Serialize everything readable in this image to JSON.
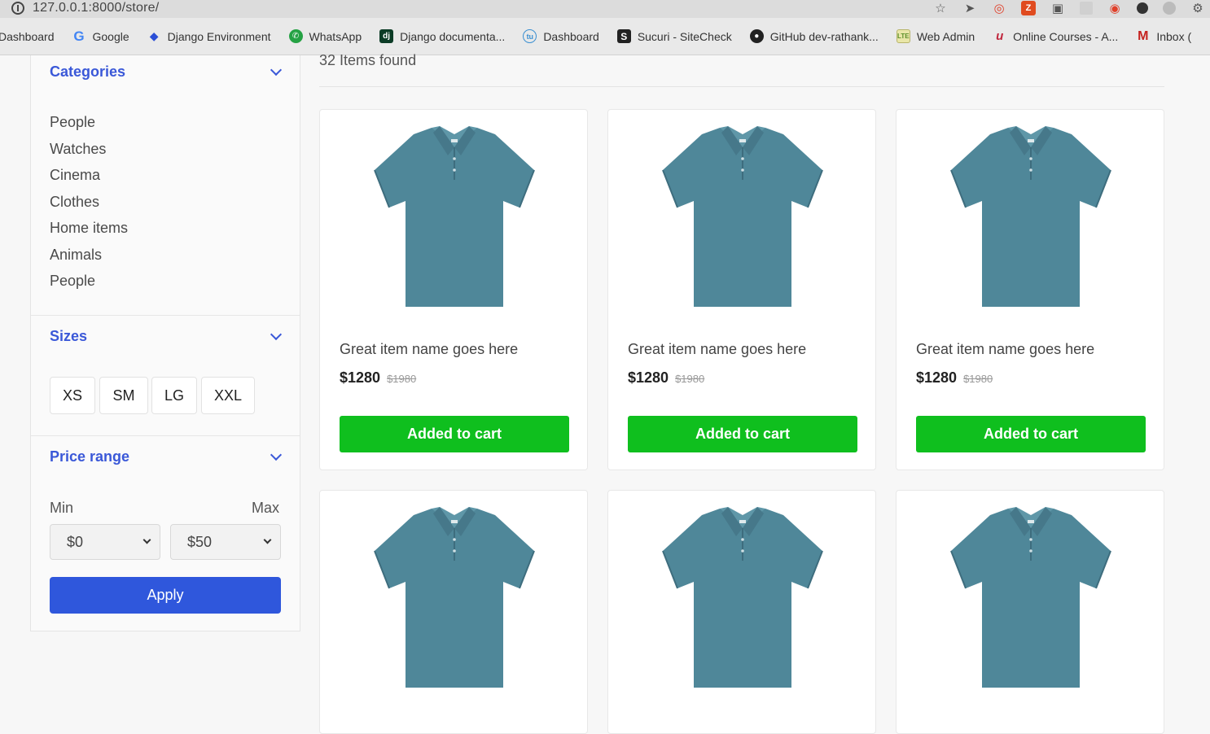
{
  "browser": {
    "url": "127.0.0.1:8000/store/",
    "bookmarks": [
      {
        "label": "Dashboard",
        "icon": "none"
      },
      {
        "label": "Google",
        "icon": "google-icon",
        "glyph": "G"
      },
      {
        "label": "Django Environment",
        "icon": "django-env-icon",
        "glyph": "◆"
      },
      {
        "label": "WhatsApp",
        "icon": "whatsapp-icon",
        "glyph": "✆"
      },
      {
        "label": "Django documenta...",
        "icon": "django-docs-icon",
        "glyph": "dj"
      },
      {
        "label": "Dashboard",
        "icon": "dashboard-icon",
        "glyph": "tu"
      },
      {
        "label": "Sucuri - SiteCheck",
        "icon": "sucuri-icon",
        "glyph": "S"
      },
      {
        "label": "GitHub dev-rathank...",
        "icon": "github-icon",
        "glyph": "●"
      },
      {
        "label": "Web Admin",
        "icon": "adminlte-icon",
        "glyph": "LTE"
      },
      {
        "label": "Online Courses - A...",
        "icon": "udemy-icon",
        "glyph": "u"
      },
      {
        "label": "Inbox (",
        "icon": "gmail-icon",
        "glyph": "M"
      }
    ]
  },
  "sidebar": {
    "categories": {
      "title": "Categories",
      "items": [
        "People",
        "Watches",
        "Cinema",
        "Clothes",
        "Home items",
        "Animals",
        "People"
      ]
    },
    "sizes": {
      "title": "Sizes",
      "options": [
        "XS",
        "SM",
        "LG",
        "XXL"
      ]
    },
    "price_range": {
      "title": "Price range",
      "min_label": "Min",
      "max_label": "Max",
      "min_value": "$0",
      "max_value": "$50",
      "apply_label": "Apply"
    }
  },
  "main": {
    "items_found": "32 Items found",
    "products": [
      {
        "name": "Great item name goes here",
        "price": "$1280",
        "old_price": "$1980",
        "button": "Added to cart"
      },
      {
        "name": "Great item name goes here",
        "price": "$1280",
        "old_price": "$1980",
        "button": "Added to cart"
      },
      {
        "name": "Great item name goes here",
        "price": "$1280",
        "old_price": "$1980",
        "button": "Added to cart"
      },
      {
        "name": "",
        "price": "",
        "old_price": "",
        "button": ""
      },
      {
        "name": "",
        "price": "",
        "old_price": "",
        "button": ""
      },
      {
        "name": "",
        "price": "",
        "old_price": "",
        "button": ""
      }
    ]
  },
  "colors": {
    "accent_blue": "#2f57dc",
    "cart_green": "#0fbf1e",
    "shirt": "#4f8799"
  }
}
